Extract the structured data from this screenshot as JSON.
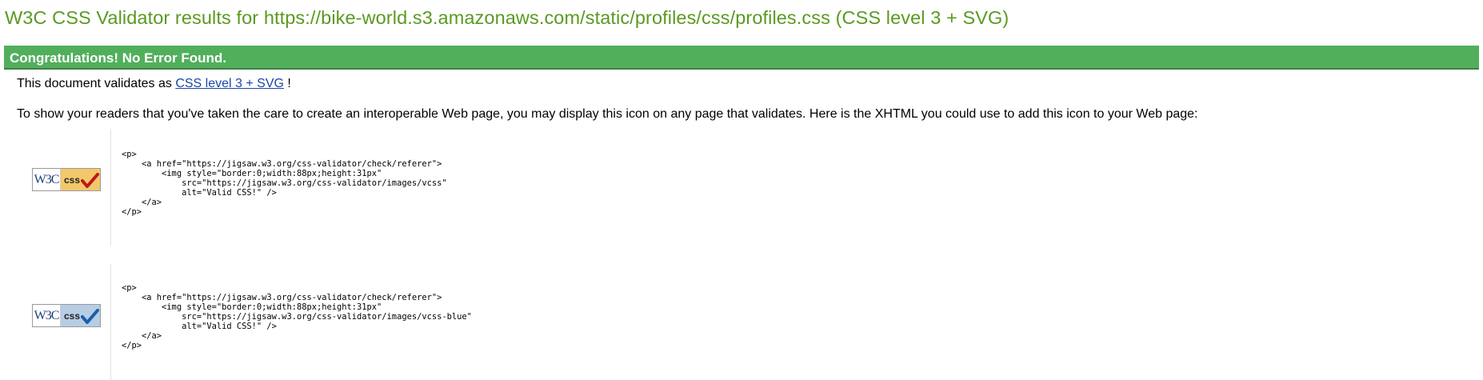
{
  "page": {
    "title": "W3C CSS Validator results for https://bike-world.s3.amazonaws.com/static/profiles/css/profiles.css (CSS level 3 + SVG)"
  },
  "result": {
    "congrats": "Congratulations! No Error Found."
  },
  "validates": {
    "prefix": "This document validates as ",
    "link_label": "CSS level 3 + SVG",
    "suffix": " !"
  },
  "readers_text": "To show your readers that you've taken the care to create an interoperable Web page, you may display this icon on any page that validates. Here is the XHTML you could use to add this icon to your Web page:",
  "badges": [
    {
      "icon": "w3c-css-valid-gold-icon",
      "w3c_label": "W3C",
      "css_label": "css",
      "colors": {
        "panel": "#f2c86a",
        "check": "#c0161c"
      },
      "code": "<p>\n    <a href=\"https://jigsaw.w3.org/css-validator/check/referer\">\n        <img style=\"border:0;width:88px;height:31px\"\n            src=\"https://jigsaw.w3.org/css-validator/images/vcss\"\n            alt=\"Valid CSS!\" />\n    </a>\n</p>"
    },
    {
      "icon": "w3c-css-valid-blue-icon",
      "w3c_label": "W3C",
      "css_label": "css",
      "colors": {
        "panel": "#b6cde4",
        "check": "#1a5ea8"
      },
      "code": "<p>\n    <a href=\"https://jigsaw.w3.org/css-validator/check/referer\">\n        <img style=\"border:0;width:88px;height:31px\"\n            src=\"https://jigsaw.w3.org/css-validator/images/vcss-blue\"\n            alt=\"Valid CSS!\" />\n    </a>\n</p>"
    }
  ],
  "theme": {
    "title_color": "#5a9a20",
    "success_bar": "#51af5c",
    "link_color": "#1a46a8"
  }
}
